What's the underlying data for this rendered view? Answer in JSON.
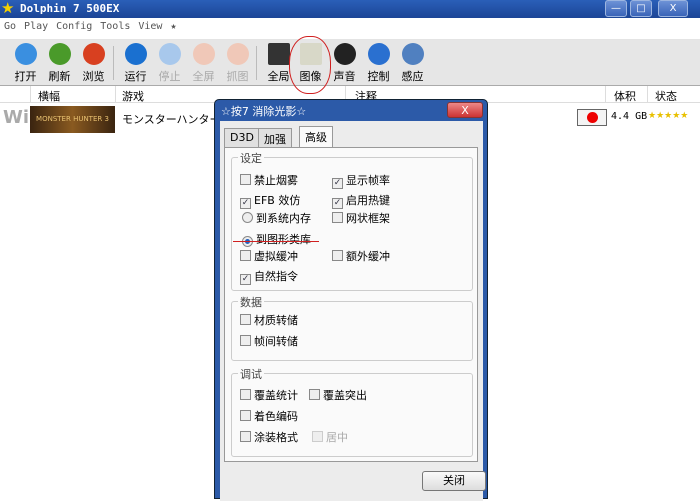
{
  "window": {
    "title": "Dolphin 7 500EX",
    "minimize": "—",
    "maximize": "□",
    "close": "X"
  },
  "menu": [
    "Go",
    "Play",
    "Config",
    "Tools",
    "View",
    "★"
  ],
  "toolbar": [
    {
      "label": "打开",
      "icon": "open-icon",
      "color": "#3a8fe0",
      "disabled": false
    },
    {
      "label": "刷新",
      "icon": "refresh-icon",
      "color": "#4a9a2a",
      "disabled": false
    },
    {
      "label": "浏览",
      "icon": "browse-icon",
      "color": "#d84020",
      "disabled": false
    },
    {
      "label": "运行",
      "icon": "play-icon",
      "color": "#1a70d0",
      "disabled": false
    },
    {
      "label": "停止",
      "icon": "stop-icon",
      "color": "#a8c8ec",
      "disabled": true
    },
    {
      "label": "全屏",
      "icon": "fullscreen-icon",
      "color": "#f0c8b8",
      "disabled": true
    },
    {
      "label": "抓图",
      "icon": "screenshot-icon",
      "color": "#f0c8b8",
      "disabled": true
    },
    {
      "label": "全局",
      "icon": "monitor-icon",
      "color": "#333",
      "disabled": false
    },
    {
      "label": "图像",
      "icon": "graphics-icon",
      "color": "#d8d8c8",
      "disabled": false
    },
    {
      "label": "声音",
      "icon": "headphones-icon",
      "color": "#222",
      "disabled": false
    },
    {
      "label": "控制",
      "icon": "controller-icon",
      "color": "#2a70d0",
      "disabled": false
    },
    {
      "label": "感应",
      "icon": "wiimote-icon",
      "color": "#5080c0",
      "disabled": false
    }
  ],
  "columns": {
    "banner": "横幅",
    "game": "游戏",
    "notes": "注释",
    "size": "体积",
    "state": "状态"
  },
  "game": {
    "platform": "Wii",
    "banner_text": "MONSTER HUNTER 3",
    "title": "モンスターハンター",
    "size": "4.4 GB",
    "rating": "★★★★★"
  },
  "dialog": {
    "title": "☆按7 消除光影☆",
    "close_icon": "X",
    "tabs": [
      "D3D",
      "加强",
      "高级"
    ],
    "groups": {
      "settings": "设定",
      "data": "数据",
      "debug": "调试"
    },
    "options": {
      "disable_fog": {
        "label": "禁止烟雾",
        "checked": false
      },
      "show_fps": {
        "label": "显示帧率",
        "checked": true
      },
      "efb_copy": {
        "label": "EFB 效仿",
        "checked": true
      },
      "hotkeys": {
        "label": "启用热键",
        "checked": true
      },
      "to_ram": {
        "label": "到系统内存",
        "checked": false
      },
      "wireframe": {
        "label": "网状框架",
        "checked": false
      },
      "to_texture": {
        "label": "到图形类库",
        "checked": true
      },
      "virtual_xfb": {
        "label": "虚拟缓冲",
        "checked": false
      },
      "real_xfb": {
        "label": "额外缓冲",
        "checked": false
      },
      "native_mips": {
        "label": "自然指令",
        "checked": true
      },
      "dump_textures": {
        "label": "材质转储",
        "checked": false
      },
      "dump_frames": {
        "label": "帧间转储",
        "checked": false
      },
      "overlay_stats": {
        "label": "覆盖统计",
        "checked": false
      },
      "overlay_proj": {
        "label": "覆盖突出",
        "checked": false
      },
      "tex_fmt_overlay": {
        "label": "着色编码",
        "checked": false
      },
      "tex_fmt": {
        "label": "涂装格式",
        "checked": false
      },
      "center": {
        "label": "居中",
        "checked": false
      }
    },
    "close_button": "关闭"
  },
  "accent": "#2c5aa8"
}
